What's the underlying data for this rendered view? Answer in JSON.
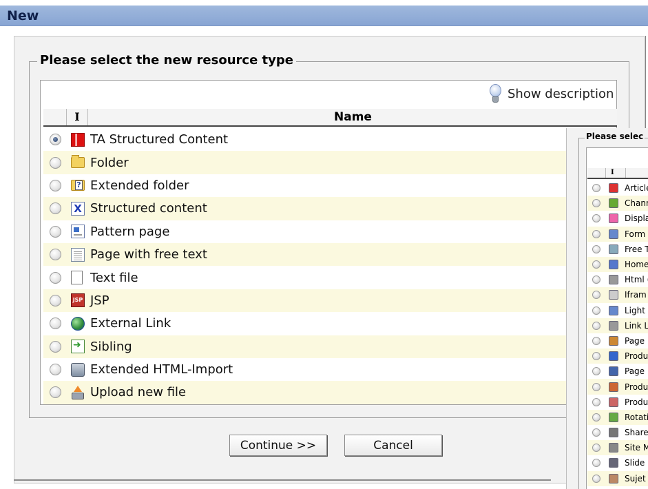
{
  "window": {
    "title": "New"
  },
  "dialog": {
    "legend": "Please select the new resource type",
    "show_description": "Show description",
    "columns": {
      "icon": "I",
      "name": "Name"
    },
    "items": [
      {
        "label": "TA Structured Content",
        "icon": "ta-structured-icon",
        "checked": true
      },
      {
        "label": "Folder",
        "icon": "folder-icon",
        "checked": false
      },
      {
        "label": "Extended folder",
        "icon": "extended-folder-icon",
        "checked": false
      },
      {
        "label": "Structured content",
        "icon": "structured-content-icon",
        "checked": false
      },
      {
        "label": "Pattern page",
        "icon": "pattern-page-icon",
        "checked": false
      },
      {
        "label": "Page with free text",
        "icon": "page-icon",
        "checked": false
      },
      {
        "label": "Text file",
        "icon": "text-file-icon",
        "checked": false
      },
      {
        "label": "JSP",
        "icon": "jsp-icon",
        "checked": false
      },
      {
        "label": "External Link",
        "icon": "external-link-icon",
        "checked": false
      },
      {
        "label": "Sibling",
        "icon": "sibling-icon",
        "checked": false
      },
      {
        "label": "Extended HTML-Import",
        "icon": "html-import-icon",
        "checked": false
      },
      {
        "label": "Upload new file",
        "icon": "upload-icon",
        "checked": false
      }
    ],
    "buttons": {
      "continue": "Continue >>",
      "cancel": "Cancel"
    }
  },
  "secondary_dialog": {
    "legend": "Please selec",
    "column_icon": "I",
    "items": [
      {
        "label": "Article"
      },
      {
        "label": "Chann"
      },
      {
        "label": "Displa"
      },
      {
        "label": "Form"
      },
      {
        "label": "Free T"
      },
      {
        "label": "Home"
      },
      {
        "label": "Html ("
      },
      {
        "label": "Ifram"
      },
      {
        "label": "Light"
      },
      {
        "label": "Link L"
      },
      {
        "label": "Page"
      },
      {
        "label": "Produ"
      },
      {
        "label": "Page"
      },
      {
        "label": "Produ"
      },
      {
        "label": "Produ"
      },
      {
        "label": "Rotati"
      },
      {
        "label": "Share"
      },
      {
        "label": "Site M"
      },
      {
        "label": "Slide"
      },
      {
        "label": "Sujet"
      }
    ]
  },
  "colors": {
    "titlebar": "#9fb8dd",
    "row_alt": "#fbf9df",
    "panel": "#f2f2f2"
  }
}
